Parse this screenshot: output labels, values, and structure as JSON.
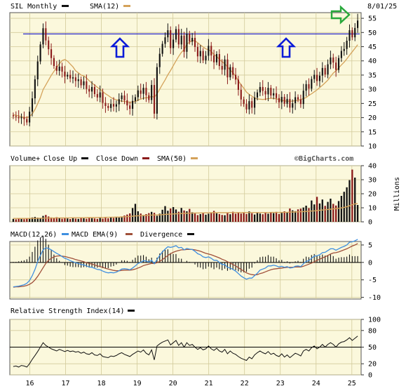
{
  "header": {
    "date_label": "8/01/25",
    "watermark": "©BigCharts.com"
  },
  "colors": {
    "plot_bg": "#fbf8dc",
    "grid": "#d2ca9a",
    "up": "#111111",
    "down": "#8b1a1a",
    "sma": "#d4a25a",
    "macd": "#3f8fe0",
    "macd_ema": "#a0503a",
    "hline": "#1010c8",
    "arrow_blue": "#0b1bd8",
    "arrow_green": "#28a83a"
  },
  "chart_data": [
    {
      "type": "candlestick",
      "panel": "price",
      "title": "SIL Monthly",
      "legend": [
        {
          "name": "SIL Monthly",
          "color": "#111111"
        },
        {
          "name": "SMA(12)",
          "color": "#d4a25a"
        }
      ],
      "x_ticks": [
        "16",
        "17",
        "18",
        "19",
        "20",
        "21",
        "22",
        "23",
        "24",
        "25"
      ],
      "y_ticks": [
        10,
        15,
        20,
        25,
        30,
        35,
        40,
        45,
        50,
        55
      ],
      "ylim": [
        10,
        57
      ],
      "horizontal_line": 49.5,
      "annotations": [
        {
          "shape": "up-arrow",
          "color": "blue",
          "near_x": 18.7
        },
        {
          "shape": "up-arrow",
          "color": "blue",
          "near_x": 23.3
        },
        {
          "shape": "right-arrow",
          "color": "green",
          "near_x": 25.2
        }
      ],
      "close": [
        20.5,
        20.2,
        19.8,
        20.1,
        19.5,
        18.3,
        22.1,
        26.8,
        33.5,
        39.8,
        45.8,
        51.5,
        47.2,
        44.1,
        41.0,
        38.2,
        36.5,
        38.0,
        36.2,
        34.5,
        35.1,
        33.8,
        34.2,
        32.9,
        33.5,
        31.4,
        32.8,
        30.1,
        29.2,
        30.8,
        28.3,
        27.1,
        28.9,
        25.2,
        24.1,
        23.4,
        24.8,
        23.9,
        24.7,
        26.5,
        27.8,
        26.1,
        24.3,
        23.1,
        25.9,
        27.2,
        29.6,
        28.4,
        30.5,
        27.9,
        26.2,
        31.5,
        21.4,
        37.8,
        42.5,
        46.0,
        48.3,
        50.8,
        44.5,
        47.5,
        51.2,
        45.8,
        48.9,
        43.2,
        49.6,
        46.8,
        48.1,
        44.9,
        41.6,
        43.5,
        40.2,
        41.8,
        45.3,
        41.9,
        39.5,
        42.4,
        38.2,
        36.9,
        40.5,
        34.2,
        37.8,
        35.1,
        33.4,
        29.8,
        26.4,
        24.8,
        22.9,
        25.8,
        23.5,
        27.1,
        28.9,
        30.8,
        29.4,
        28.2,
        30.5,
        27.8,
        28.6,
        26.9,
        25.4,
        27.3,
        24.9,
        26.6,
        23.5,
        25.1,
        27.2,
        26.4,
        24.8,
        29.5,
        31.8,
        30.2,
        33.6,
        35.1,
        32.9,
        34.8,
        37.5,
        35.2,
        38.8,
        41.2,
        39.4,
        36.8,
        41.0,
        43.5,
        44.2,
        47.1,
        50.8,
        48.3,
        51.6,
        54.2
      ],
      "sma12": [
        21.0,
        20.8,
        20.6,
        20.3,
        20.1,
        20.0,
        20.4,
        21.3,
        22.9,
        24.9,
        27.1,
        29.9,
        31.5,
        33.2,
        34.9,
        36.3,
        37.7,
        39.0,
        40.1,
        40.5,
        39.9,
        38.9,
        37.9,
        36.5,
        35.8,
        35.0,
        34.7,
        34.0,
        33.0,
        32.2,
        31.5,
        30.7,
        30.0,
        29.2,
        28.4,
        27.8,
        27.1,
        26.6,
        26.3,
        26.0,
        25.8,
        25.7,
        25.5,
        25.4,
        25.5,
        25.7,
        26.2,
        26.5,
        26.9,
        27.0,
        27.1,
        27.5,
        27.2,
        28.4,
        30.0,
        31.7,
        33.3,
        35.1,
        36.6,
        38.3,
        40.0,
        41.6,
        43.0,
        44.0,
        45.9,
        46.6,
        47.1,
        47.1,
        46.4,
        45.6,
        44.9,
        44.2,
        44.0,
        43.3,
        42.2,
        41.6,
        40.5,
        39.7,
        39.0,
        37.9,
        36.8,
        35.8,
        34.6,
        33.0,
        31.6,
        30.4,
        29.0,
        28.2,
        27.6,
        26.9,
        26.6,
        26.5,
        26.4,
        26.5,
        26.7,
        26.8,
        26.8,
        26.6,
        26.4,
        26.1,
        25.9,
        25.8,
        25.8,
        25.8,
        26.0,
        26.1,
        26.4,
        26.7,
        27.1,
        27.8,
        28.4,
        29.1,
        29.8,
        30.6,
        31.4,
        32.3,
        33.2,
        34.5,
        35.7,
        36.5,
        37.5,
        38.6,
        39.5,
        40.7,
        42.0,
        43.2,
        44.4,
        45.7
      ]
    },
    {
      "type": "bar",
      "panel": "volume",
      "title": "Volume+ Close Up / Close Down",
      "legend": [
        {
          "name": "Volume+",
          "color": ""
        },
        {
          "name": "Close Up",
          "color": "#111111"
        },
        {
          "name": "Close Down",
          "color": "#8b1a1a"
        },
        {
          "name": "SMA(50)",
          "color": "#d4a25a"
        }
      ],
      "ylabel": "Millions",
      "y_ticks": [
        0,
        10,
        20,
        30,
        40
      ],
      "ylim": [
        0,
        40
      ],
      "values": [
        2.1,
        1.8,
        2.4,
        2.0,
        1.9,
        2.6,
        2.3,
        3.1,
        3.5,
        3.0,
        2.8,
        4.2,
        4.9,
        3.8,
        3.1,
        2.7,
        3.3,
        2.5,
        2.2,
        2.9,
        2.4,
        2.0,
        2.6,
        2.3,
        2.1,
        2.8,
        2.5,
        2.2,
        3.0,
        2.6,
        2.4,
        2.1,
        2.7,
        2.3,
        2.9,
        2.5,
        3.2,
        2.8,
        3.5,
        3.1,
        3.8,
        4.5,
        5.2,
        6.0,
        9.8,
        12.8,
        7.5,
        5.9,
        4.8,
        5.5,
        6.2,
        7.1,
        6.4,
        4.3,
        5.8,
        8.6,
        11.2,
        7.9,
        9.5,
        10.5,
        8.8,
        7.2,
        9.9,
        8.1,
        7.5,
        9.2,
        6.8,
        5.9,
        4.8,
        5.5,
        6.2,
        5.1,
        5.8,
        6.4,
        7.8,
        6.1,
        5.5,
        4.9,
        4.7,
        6.6,
        5.4,
        7.2,
        5.8,
        6.3,
        5.9,
        6.8,
        5.6,
        7.4,
        6.1,
        5.2,
        6.7,
        5.9,
        5.4,
        6.3,
        5.8,
        6.9,
        6.2,
        7.1,
        5.6,
        6.4,
        7.5,
        6.8,
        9.5,
        8.2,
        7.6,
        8.9,
        9.4,
        10.2,
        11.5,
        9.8,
        15.2,
        12.4,
        17.8,
        13.1,
        15.9,
        11.4,
        14.2,
        16.5,
        12.8,
        11.6,
        14.8,
        18.5,
        21.4,
        24.6,
        29.7,
        37.2,
        31.5,
        12.0
      ],
      "up": [
        true,
        false,
        false,
        true,
        false,
        false,
        true,
        true,
        true,
        true,
        true,
        true,
        false,
        false,
        false,
        false,
        false,
        true,
        false,
        false,
        true,
        false,
        true,
        false,
        true,
        false,
        true,
        false,
        false,
        true,
        false,
        false,
        true,
        false,
        false,
        false,
        true,
        false,
        true,
        true,
        true,
        false,
        false,
        false,
        true,
        true,
        true,
        false,
        true,
        false,
        false,
        true,
        false,
        true,
        true,
        true,
        true,
        true,
        false,
        true,
        true,
        false,
        true,
        false,
        true,
        false,
        true,
        false,
        false,
        true,
        false,
        true,
        true,
        false,
        false,
        true,
        false,
        false,
        true,
        false,
        true,
        false,
        false,
        false,
        false,
        false,
        false,
        true,
        false,
        true,
        true,
        true,
        false,
        false,
        true,
        false,
        true,
        false,
        false,
        true,
        false,
        true,
        false,
        true,
        true,
        false,
        false,
        true,
        true,
        false,
        true,
        true,
        false,
        true,
        true,
        false,
        true,
        true,
        false,
        false,
        true,
        true,
        true,
        true,
        true,
        false,
        true,
        true
      ],
      "sma50": [
        2.4,
        2.4,
        2.4,
        2.4,
        2.4,
        2.4,
        2.4,
        2.5,
        2.5,
        2.5,
        2.6,
        2.6,
        2.7,
        2.7,
        2.7,
        2.7,
        2.8,
        2.8,
        2.8,
        2.8,
        2.8,
        2.8,
        2.9,
        2.9,
        2.9,
        2.9,
        2.9,
        3.0,
        3.0,
        3.0,
        3.0,
        3.1,
        3.1,
        3.1,
        3.2,
        3.2,
        3.3,
        3.3,
        3.4,
        3.4,
        3.5,
        3.6,
        3.7,
        3.8,
        4.0,
        4.2,
        4.3,
        4.4,
        4.5,
        4.6,
        4.7,
        4.8,
        4.9,
        4.9,
        5.0,
        5.1,
        5.3,
        5.4,
        5.5,
        5.6,
        5.7,
        5.8,
        5.9,
        6.0,
        6.1,
        6.2,
        6.2,
        6.3,
        6.3,
        6.3,
        6.4,
        6.4,
        6.4,
        6.5,
        6.5,
        6.5,
        6.5,
        6.5,
        6.5,
        6.5,
        6.6,
        6.6,
        6.6,
        6.6,
        6.6,
        6.6,
        6.6,
        6.6,
        6.6,
        6.6,
        6.6,
        6.6,
        6.6,
        6.6,
        6.6,
        6.7,
        6.7,
        6.7,
        6.7,
        6.7,
        6.8,
        6.8,
        6.9,
        7.0,
        7.0,
        7.1,
        7.2,
        7.3,
        7.4,
        7.5,
        7.7,
        7.8,
        8.0,
        8.2,
        8.4,
        8.6,
        8.8,
        9.0,
        9.2,
        9.4,
        9.6,
        9.9,
        10.3,
        10.8,
        11.4,
        12.2,
        12.8,
        13.0
      ]
    },
    {
      "type": "line",
      "panel": "macd",
      "title": "MACD(12,26)",
      "legend": [
        {
          "name": "MACD(12,26)",
          "color": ""
        },
        {
          "name": "MACD EMA(9)",
          "color": "#3f8fe0"
        },
        {
          "name": "Divergence",
          "color": "#111111"
        }
      ],
      "y_ticks": [
        5,
        0,
        -5,
        -10
      ],
      "ylim": [
        -10.5,
        6
      ],
      "macd": [
        -7.0,
        -6.9,
        -6.8,
        -6.6,
        -6.4,
        -6.0,
        -5.2,
        -3.8,
        -2.0,
        0.2,
        2.0,
        3.6,
        4.2,
        4.0,
        3.6,
        3.1,
        2.6,
        2.2,
        1.7,
        1.2,
        0.9,
        0.5,
        0.2,
        -0.1,
        -0.3,
        -0.6,
        -0.7,
        -1.0,
        -1.3,
        -1.4,
        -1.7,
        -2.0,
        -2.1,
        -2.5,
        -2.8,
        -3.0,
        -2.9,
        -3.0,
        -2.8,
        -2.4,
        -1.9,
        -1.8,
        -1.9,
        -2.1,
        -1.6,
        -1.0,
        -0.3,
        0.0,
        0.5,
        0.4,
        0.1,
        0.6,
        -0.4,
        0.8,
        2.0,
        3.0,
        3.8,
        4.5,
        4.3,
        4.5,
        4.8,
        4.2,
        4.3,
        3.6,
        4.0,
        3.8,
        3.7,
        3.2,
        2.5,
        2.2,
        1.6,
        1.4,
        1.6,
        1.2,
        0.6,
        0.6,
        0.0,
        -0.6,
        -0.6,
        -1.4,
        -1.6,
        -2.0,
        -2.5,
        -3.2,
        -3.9,
        -4.4,
        -4.8,
        -4.5,
        -4.5,
        -3.8,
        -3.1,
        -2.2,
        -1.9,
        -1.6,
        -1.0,
        -1.0,
        -0.8,
        -1.0,
        -1.3,
        -1.1,
        -1.4,
        -1.2,
        -1.6,
        -1.5,
        -1.1,
        -1.0,
        -1.2,
        -0.4,
        0.3,
        0.5,
        1.2,
        1.8,
        1.9,
        2.2,
        2.8,
        2.9,
        3.4,
        3.9,
        3.9,
        3.5,
        3.9,
        4.3,
        4.6,
        5.0,
        5.8,
        5.9,
        6.2,
        6.6
      ],
      "ema9": [
        -7.1,
        -7.0,
        -7.0,
        -6.9,
        -6.8,
        -6.6,
        -6.3,
        -5.8,
        -5.0,
        -4.0,
        -2.8,
        -1.5,
        -0.3,
        0.6,
        1.2,
        1.6,
        1.8,
        1.9,
        1.8,
        1.7,
        1.5,
        1.3,
        1.1,
        0.8,
        0.6,
        0.4,
        0.2,
        -0.1,
        -0.3,
        -0.5,
        -0.7,
        -1.0,
        -1.2,
        -1.4,
        -1.7,
        -1.9,
        -2.1,
        -2.3,
        -2.4,
        -2.4,
        -2.3,
        -2.2,
        -2.2,
        -2.2,
        -2.1,
        -1.9,
        -1.6,
        -1.3,
        -0.9,
        -0.7,
        -0.5,
        -0.3,
        -0.3,
        -0.1,
        0.3,
        0.8,
        1.4,
        2.0,
        2.5,
        2.9,
        3.2,
        3.4,
        3.6,
        3.6,
        3.7,
        3.7,
        3.7,
        3.6,
        3.4,
        3.2,
        2.9,
        2.6,
        2.4,
        2.2,
        1.9,
        1.6,
        1.3,
        0.9,
        0.6,
        0.2,
        -0.2,
        -0.6,
        -1.0,
        -1.5,
        -2.0,
        -2.5,
        -3.0,
        -3.3,
        -3.5,
        -3.6,
        -3.5,
        -3.2,
        -3.0,
        -2.7,
        -2.4,
        -2.1,
        -1.9,
        -1.8,
        -1.7,
        -1.6,
        -1.5,
        -1.4,
        -1.4,
        -1.4,
        -1.3,
        -1.3,
        -1.3,
        -1.1,
        -0.8,
        -0.5,
        -0.2,
        0.2,
        0.6,
        0.9,
        1.3,
        1.6,
        2.0,
        2.4,
        2.7,
        2.8,
        3.0,
        3.3,
        3.6,
        3.9,
        4.3,
        4.7,
        5.0,
        5.4
      ]
    },
    {
      "type": "line",
      "panel": "rsi",
      "title": "Relative Strength Index(14)",
      "legend": [
        {
          "name": "Relative Strength Index(14)",
          "color": "#111111"
        }
      ],
      "y_ticks": [
        100,
        80,
        50,
        20,
        0
      ],
      "ylim": [
        0,
        100
      ],
      "reference_line": 50,
      "x_ticks": [
        "16",
        "17",
        "18",
        "19",
        "20",
        "21",
        "22",
        "23",
        "24",
        "25"
      ],
      "values": [
        15,
        16,
        14,
        17,
        16,
        14,
        20,
        28,
        35,
        42,
        50,
        58,
        53,
        50,
        47,
        45,
        43,
        46,
        44,
        42,
        44,
        42,
        43,
        41,
        42,
        39,
        41,
        38,
        37,
        40,
        36,
        35,
        38,
        33,
        32,
        31,
        34,
        33,
        35,
        38,
        40,
        37,
        35,
        33,
        37,
        40,
        43,
        41,
        45,
        39,
        36,
        45,
        27,
        52,
        56,
        59,
        61,
        63,
        54,
        58,
        62,
        53,
        58,
        50,
        58,
        53,
        55,
        50,
        46,
        49,
        45,
        47,
        52,
        47,
        44,
        48,
        43,
        41,
        46,
        38,
        43,
        39,
        37,
        33,
        30,
        28,
        26,
        32,
        29,
        36,
        40,
        43,
        40,
        38,
        42,
        37,
        39,
        35,
        33,
        38,
        32,
        36,
        31,
        35,
        39,
        37,
        34,
        43,
        46,
        43,
        49,
        52,
        47,
        50,
        55,
        50,
        55,
        58,
        55,
        50,
        56,
        59,
        60,
        63,
        67,
        62,
        66,
        70
      ]
    }
  ]
}
